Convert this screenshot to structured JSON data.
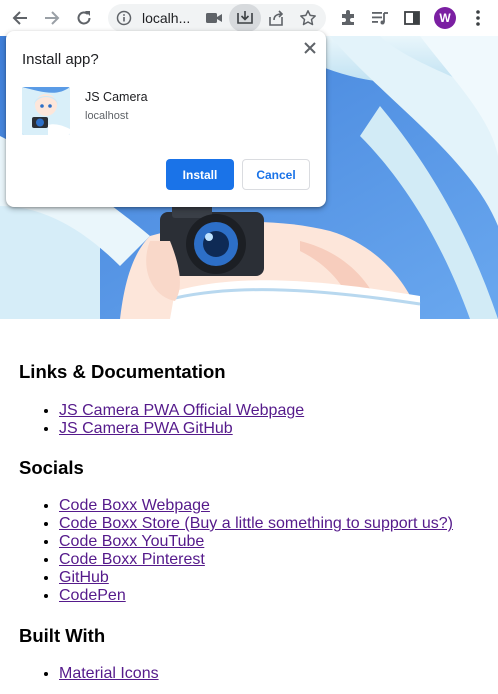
{
  "browser": {
    "url": "localh...",
    "profile_initial": "W",
    "icons": [
      "back-icon",
      "forward-icon",
      "reload-icon",
      "info-icon",
      "camera-icon",
      "install-app-icon",
      "share-icon",
      "bookmark-star-icon",
      "extensions-icon",
      "media-controls-icon",
      "side-panel-icon",
      "avatar",
      "menu-icon"
    ]
  },
  "install_dialog": {
    "title": "Install app?",
    "app_name": "JS Camera",
    "app_origin": "localhost",
    "install_label": "Install",
    "cancel_label": "Cancel"
  },
  "sections": [
    {
      "heading": "Links & Documentation",
      "links": [
        "JS Camera PWA Official Webpage",
        "JS Camera PWA GitHub"
      ]
    },
    {
      "heading": "Socials",
      "links": [
        "Code Boxx Webpage",
        "Code Boxx Store (Buy a little something to support us?)",
        "Code Boxx YouTube",
        "Code Boxx Pinterest",
        "GitHub",
        "CodePen"
      ]
    },
    {
      "heading": "Built With",
      "links": [
        "Material Icons"
      ]
    }
  ],
  "colors": {
    "link": "#551a8b",
    "accent": "#1a73e8",
    "avatar": "#7b1fa2"
  }
}
